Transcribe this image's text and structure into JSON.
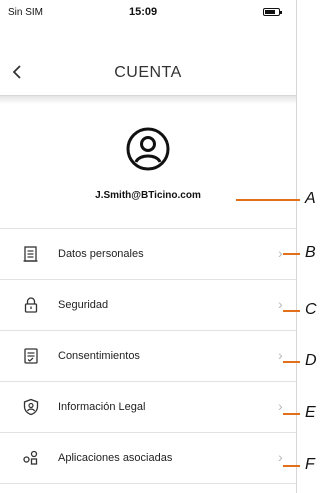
{
  "status_bar": {
    "carrier": "Sin SIM",
    "time": "15:09"
  },
  "header": {
    "back_icon": "chevron-left-icon",
    "title": "CUENTA"
  },
  "profile": {
    "avatar_icon": "user-circle-icon",
    "email": "J.Smith@BTicino.com"
  },
  "menu": {
    "items": [
      {
        "label": "Datos personales",
        "icon": "document-icon"
      },
      {
        "label": "Seguridad",
        "icon": "lock-icon"
      },
      {
        "label": "Consentimientos",
        "icon": "checklist-document-icon"
      },
      {
        "label": "Información Legal",
        "icon": "shield-user-icon"
      },
      {
        "label": "Aplicaciones asociadas",
        "icon": "apps-icon"
      }
    ]
  },
  "callouts": [
    "A",
    "B",
    "C",
    "D",
    "E",
    "F"
  ],
  "colors": {
    "accent_callout": "#e2701a",
    "divider": "#e2e2e2",
    "chevron": "#b8b8b8"
  }
}
